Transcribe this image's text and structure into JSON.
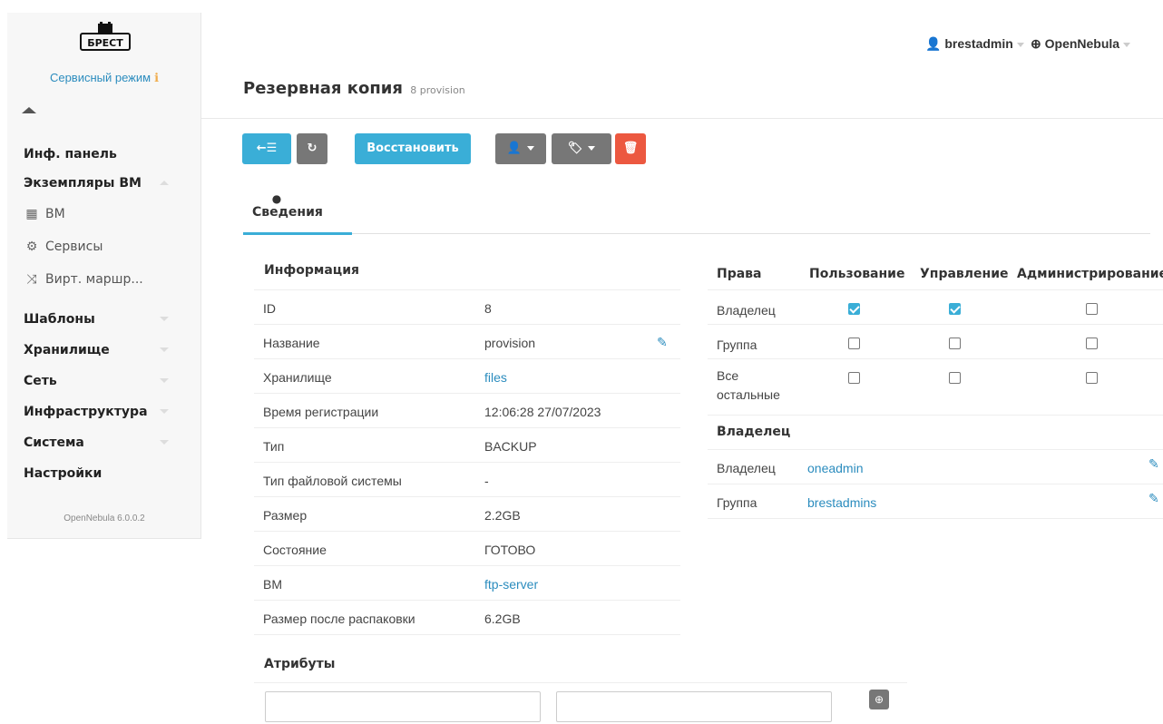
{
  "app": {
    "logo_text": "БРЕСТ",
    "service_mode": "Сервисный режим",
    "version": "OpenNebula 6.0.0.2"
  },
  "topbar": {
    "user": "brestadmin",
    "zone": "OpenNebula"
  },
  "sidebar": {
    "items": [
      {
        "label": "Инф. панель"
      },
      {
        "label": "Экземпляры ВМ"
      },
      {
        "label": "ВМ"
      },
      {
        "label": "Сервисы"
      },
      {
        "label": "Вирт. маршр..."
      },
      {
        "label": "Шаблоны"
      },
      {
        "label": "Хранилище"
      },
      {
        "label": "Сеть"
      },
      {
        "label": "Инфраструктура"
      },
      {
        "label": "Система"
      },
      {
        "label": "Настройки"
      }
    ]
  },
  "page": {
    "title": "Резервная копия",
    "subtitle": "8 provision"
  },
  "toolbar": {
    "restore_label": "Восстановить"
  },
  "tabs": [
    {
      "label": "Сведения"
    }
  ],
  "info": {
    "header": "Информация",
    "rows": [
      {
        "key": "ID",
        "value": "8"
      },
      {
        "key": "Название",
        "value": "provision"
      },
      {
        "key": "Хранилище",
        "value": "files"
      },
      {
        "key": "Время регистрации",
        "value": "12:06:28 27/07/2023"
      },
      {
        "key": "Тип",
        "value": "BACKUP"
      },
      {
        "key": "Тип файловой системы",
        "value": "-"
      },
      {
        "key": "Размер",
        "value": "2.2GB"
      },
      {
        "key": "Состояние",
        "value": "ГОТОВО"
      },
      {
        "key": "ВМ",
        "value": "ftp-server"
      },
      {
        "key": "Размер после распаковки",
        "value": "6.2GB"
      }
    ]
  },
  "permissions": {
    "header": "Права",
    "columns": [
      "Пользование",
      "Управление",
      "Администрирование"
    ],
    "rows": [
      {
        "label": "Владелец",
        "checks": [
          true,
          true,
          false
        ]
      },
      {
        "label": "Группа",
        "checks": [
          false,
          false,
          false
        ]
      },
      {
        "label": "Все остальные",
        "checks": [
          false,
          false,
          false
        ]
      }
    ]
  },
  "ownership": {
    "header": "Владелец",
    "owner_label": "Владелец",
    "owner_value": "oneadmin",
    "group_label": "Группа",
    "group_value": "brestadmins"
  },
  "attributes": {
    "header": "Атрибуты",
    "key_value": "",
    "value_value": ""
  }
}
